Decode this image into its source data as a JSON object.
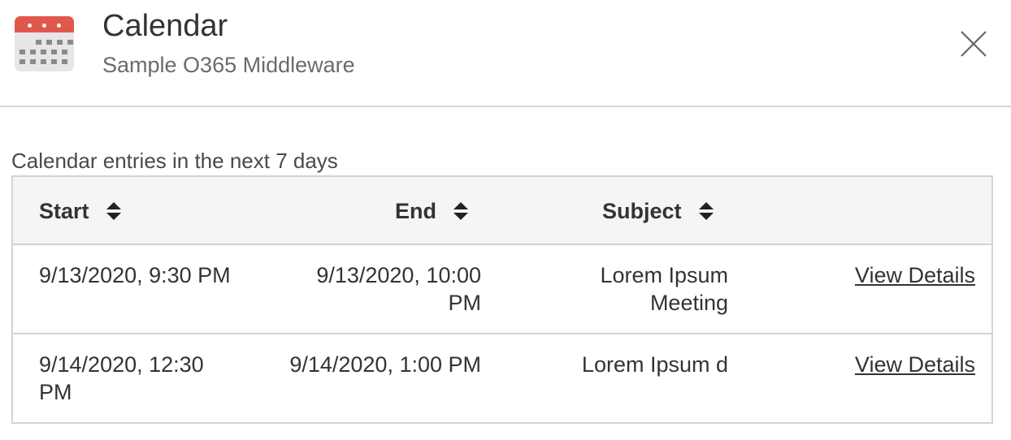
{
  "header": {
    "title": "Calendar",
    "subtitle": "Sample O365 Middleware",
    "icon": "calendar-icon",
    "close_icon": "close-icon"
  },
  "section": {
    "caption": "Calendar entries in the next 7 days"
  },
  "table": {
    "columns": [
      {
        "label": "Start",
        "sortable": true
      },
      {
        "label": "End",
        "sortable": true
      },
      {
        "label": "Subject",
        "sortable": true
      }
    ],
    "rows": [
      {
        "start": "9/13/2020, 9:30 PM",
        "end": "9/13/2020, 10:00 PM",
        "subject": "Lorem Ipsum Meeting",
        "action": "View Details"
      },
      {
        "start": "9/14/2020, 12:30 PM",
        "end": "9/14/2020, 1:00 PM",
        "subject": "Lorem Ipsum d",
        "action": "View Details"
      }
    ]
  },
  "colors": {
    "calendar_accent": "#e2574c",
    "border": "#d3d3d3",
    "header_bg": "#f5f5f5"
  }
}
